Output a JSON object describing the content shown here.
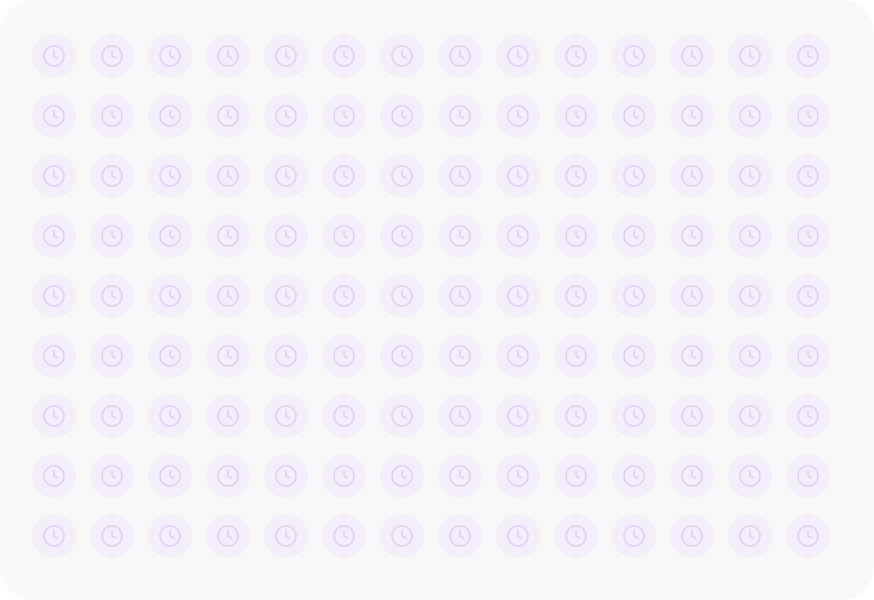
{
  "grid": {
    "rows": 9,
    "columns": 14,
    "icon": "clock-icon"
  },
  "colors": {
    "panel_background": "#f8f8f8",
    "tile_background": "#f3eef9",
    "icon_stroke": "#e3ccf4"
  }
}
